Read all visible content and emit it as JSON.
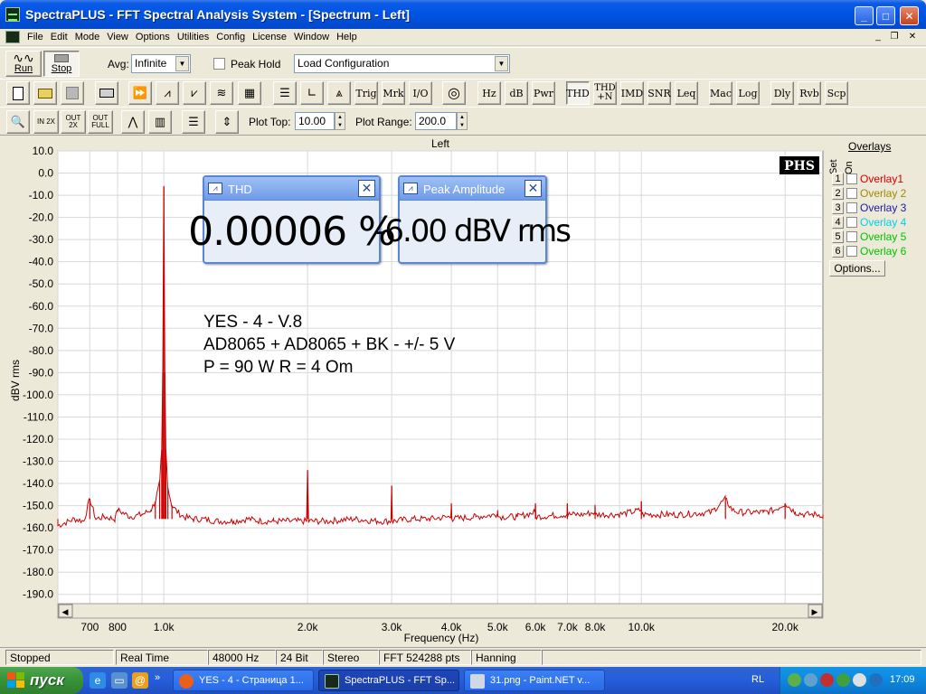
{
  "window": {
    "title": "SpectraPLUS - FFT Spectral Analysis System - [Spectrum - Left]"
  },
  "menu": [
    "File",
    "Edit",
    "Mode",
    "View",
    "Options",
    "Utilities",
    "Config",
    "License",
    "Window",
    "Help"
  ],
  "toolbar1": {
    "run_label": "Run",
    "stop_label": "Stop",
    "avg_label": "Avg:",
    "avg_value": "Infinite",
    "peak_hold_label": "Peak Hold",
    "load_config_value": "Load Configuration"
  },
  "toolbar2": {
    "text_buttons": [
      "Trig",
      "Mrk",
      "I/O",
      "Hz",
      "dB",
      "Pwr",
      "THD",
      "THD +N",
      "IMD",
      "SNR",
      "Leq",
      "Mac",
      "Log",
      "Dly",
      "Rvb",
      "Scp"
    ],
    "icons": [
      "new-file-icon",
      "open-folder-icon",
      "save-disk-icon",
      "print-icon",
      "fast-forward-icon",
      "waveform-icon",
      "sawtooth-icon",
      "waterfall-icon",
      "spectrogram-icon",
      "analyzer-icon",
      "chart-axes-icon",
      "phase-icon",
      "circle-wave-icon"
    ]
  },
  "toolbar3": {
    "zoom_in_label": "IN 2X",
    "zoom_out_label": "OUT 2X",
    "zoom_full_label": "OUT FULL",
    "plot_top_label": "Plot Top:",
    "plot_top_value": "10.00",
    "plot_range_label": "Plot Range:",
    "plot_range_value": "200.0"
  },
  "meters": {
    "thd": {
      "title": "THD",
      "value": "0.00006 %"
    },
    "peak": {
      "title": "Peak Amplitude",
      "value": "-6.00 dBV rms"
    }
  },
  "overlays": {
    "title": "Overlays",
    "set_label": "Set",
    "on_label": "On",
    "items": [
      {
        "num": "1",
        "name": "Overlay1",
        "color": "#d40000"
      },
      {
        "num": "2",
        "name": "Overlay 2",
        "color": "#a08a00"
      },
      {
        "num": "3",
        "name": "Overlay 3",
        "color": "#1a1aa0"
      },
      {
        "num": "4",
        "name": "Overlay 4",
        "color": "#00d0e8"
      },
      {
        "num": "5",
        "name": "Overlay 5",
        "color": "#00c000"
      },
      {
        "num": "6",
        "name": "Overlay 6",
        "color": "#00c000"
      }
    ],
    "options_label": "Options..."
  },
  "chart_data": {
    "type": "line",
    "title": "Left",
    "xlabel": "Frequency (Hz)",
    "ylabel": "dBV rms",
    "x_scale": "log",
    "xlim": [
      600,
      24000
    ],
    "ylim": [
      -195,
      10
    ],
    "yticks": [
      10.0,
      0.0,
      -10.0,
      -20.0,
      -30.0,
      -40.0,
      -50.0,
      -60.0,
      -70.0,
      -80.0,
      -90.0,
      -100.0,
      -110.0,
      -120.0,
      -130.0,
      -140.0,
      -150.0,
      -160.0,
      -170.0,
      -180.0,
      -190.0
    ],
    "ytick_labels": [
      "10.0",
      "0.0",
      "-10.0",
      "-20.0",
      "-30.0",
      "-40.0",
      "-50.0",
      "-60.0",
      "-70.0",
      "-80.0",
      "-90.0",
      "-100.0",
      "-110.0",
      "-120.0",
      "-130.0",
      "-140.0",
      "-150.0",
      "-160.0",
      "-170.0",
      "-180.0",
      "-190.0"
    ],
    "xticks": [
      700,
      800,
      1000,
      2000,
      3000,
      4000,
      5000,
      6000,
      7000,
      8000,
      10000,
      20000
    ],
    "xtick_labels": [
      "700",
      "800",
      "1.0k",
      "2.0k",
      "3.0k",
      "4.0k",
      "5.0k",
      "6.0k",
      "7.0k",
      "8.0k",
      "10.0k",
      "20.0k"
    ],
    "grid": true,
    "line_color": "#cc0000",
    "logo": "PHS",
    "annotation_lines": [
      "YES - 4 - V.8",
      "AD8065 + AD8065 + BK - +/- 5 V",
      "P = 90 W  R = 4 Om"
    ],
    "noise_floor_db": -156,
    "series": [
      {
        "x": [
          600,
          650,
          680,
          700,
          720,
          750,
          790,
          800,
          850,
          900,
          940,
          960,
          980,
          990,
          995,
          1000,
          1005,
          1010,
          1020,
          1040,
          1070,
          1100,
          1150,
          1200,
          1300,
          1400,
          1500,
          1600,
          1700,
          1800,
          1900,
          1990,
          2000,
          2010,
          2200,
          2500,
          2800,
          2990,
          3000,
          3010,
          3300,
          3600,
          3990,
          4000,
          4010,
          4500,
          4990,
          5000,
          5010,
          5500,
          5990,
          6000,
          6010,
          6990,
          7000,
          7010,
          7500,
          7990,
          8000,
          8010,
          9000,
          9990,
          10000,
          10010,
          12000,
          14000,
          15000,
          15500,
          16000,
          18000,
          19000,
          20000,
          21000,
          22000,
          23000,
          24000
        ],
        "y": [
          -159,
          -156,
          -157,
          -147,
          -156,
          -155,
          -156,
          -152,
          -155,
          -154,
          -152,
          -148,
          -140,
          -125,
          -90,
          -6,
          -90,
          -125,
          -142,
          -150,
          -153,
          -155,
          -156,
          -156,
          -157,
          -157,
          -156,
          -157,
          -157,
          -157,
          -157,
          -157,
          -134,
          -157,
          -157,
          -156,
          -157,
          -157,
          -141,
          -157,
          -156,
          -156,
          -155,
          -149,
          -156,
          -155,
          -154,
          -152,
          -155,
          -155,
          -153,
          -149,
          -155,
          -154,
          -149,
          -154,
          -154,
          -153,
          -150,
          -154,
          -154,
          -152,
          -148,
          -154,
          -154,
          -153,
          -147,
          -152,
          -153,
          -153,
          -152,
          -149,
          -153,
          -154,
          -154,
          -154
        ]
      }
    ]
  },
  "status": {
    "state": "Stopped",
    "mode": "Real Time",
    "rate": "48000 Hz",
    "bits": "24 Bit",
    "channels": "Stereo",
    "fft": "FFT 524288 pts",
    "window": "Hanning"
  },
  "taskbar": {
    "start_label": "пуск",
    "tasks": [
      "YES - 4 - Страница 1...",
      "SpectraPLUS - FFT Sp...",
      "31.png - Paint.NET v..."
    ],
    "lang": "RL",
    "clock": "17:09"
  }
}
